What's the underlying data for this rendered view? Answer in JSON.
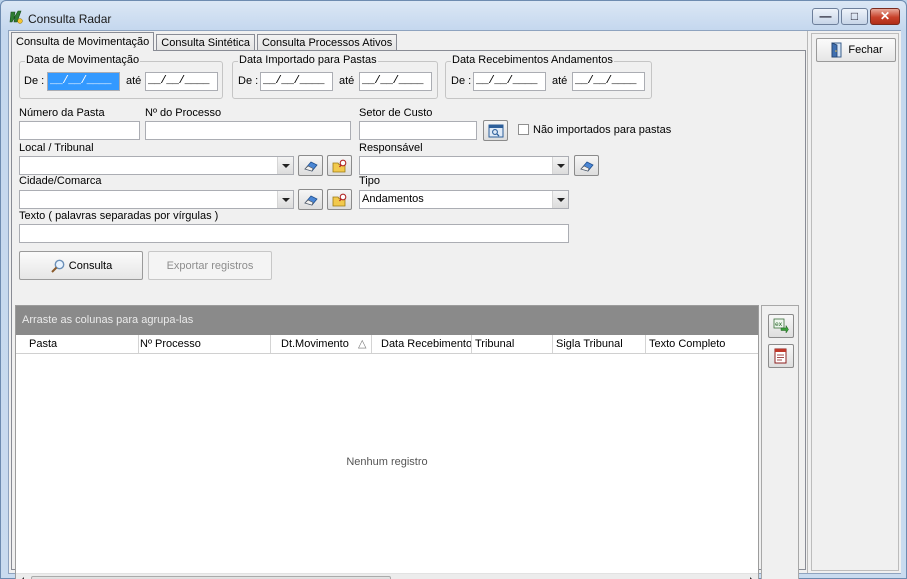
{
  "window": {
    "title": "Consulta Radar",
    "controls": {
      "minimize": "—",
      "maximize": "□",
      "close": "✕"
    }
  },
  "tabs": [
    "Consulta de Movimentação",
    "Consulta Sintética",
    "Consulta Processos Ativos"
  ],
  "filters": {
    "data_movimentacao": {
      "legend": "Data de Movimentação",
      "de_label": "De :",
      "de_value": "__/__/____",
      "ate_label": "até",
      "ate_value": "__/__/____"
    },
    "data_importado": {
      "legend": "Data Importado para Pastas",
      "de_label": "De :",
      "de_value": "__/__/____",
      "ate_label": "até",
      "ate_value": "__/__/____"
    },
    "data_recebimentos": {
      "legend": "Data Recebimentos Andamentos",
      "de_label": "De :",
      "de_value": "__/__/____",
      "ate_label": "até",
      "ate_value": "__/__/____"
    },
    "numero_pasta_label": "Número da Pasta",
    "numero_processo_label": "Nº do Processo",
    "setor_custo_label": "Setor de Custo",
    "nao_importados_label": "Não importados para pastas",
    "local_tribunal_label": "Local / Tribunal",
    "responsavel_label": "Responsável",
    "cidade_comarca_label": "Cidade/Comarca",
    "tipo_label": "Tipo",
    "tipo_value": "Andamentos",
    "texto_label": "Texto  ( palavras separadas por vírgulas )"
  },
  "buttons": {
    "consulta": "Consulta",
    "exportar": "Exportar registros",
    "fechar": "Fechar"
  },
  "grid": {
    "group_panel_text": "Arraste as colunas para agrupa-las",
    "columns": [
      "Pasta",
      "Nº Processo",
      "Dt.Movimento",
      "Data Recebimento",
      "Tribunal",
      "Sigla Tribunal",
      "Texto Completo"
    ],
    "sort_indicator": "△",
    "empty_text": "Nenhum registro"
  },
  "colors": {
    "selection": "#3399ff",
    "group_panel": "#8a8a8a",
    "window_frame": "#c4d7ee"
  }
}
